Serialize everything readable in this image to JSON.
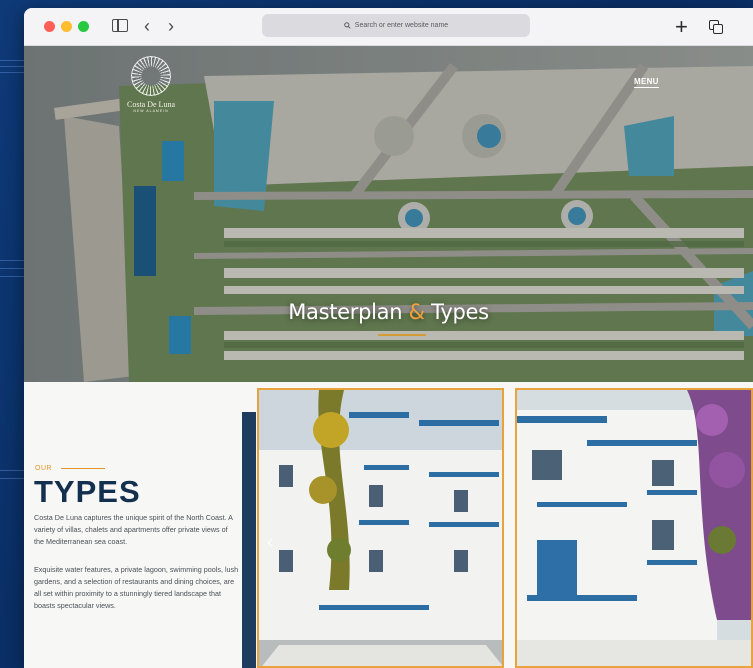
{
  "browser": {
    "url_placeholder": "Search or enter website name",
    "icons": [
      "sidebar-icon",
      "back-icon",
      "forward-icon",
      "search-icon",
      "new-tab-icon",
      "tabs-overview-icon"
    ]
  },
  "header": {
    "logo_name": "Costa De Luna",
    "logo_subtitle": "NEW ALAMEIN",
    "menu_label": "MENU"
  },
  "hero": {
    "title_part1": "Masterplan",
    "title_amp": "&",
    "title_part2": "Types",
    "accent_color": "#f2a23a"
  },
  "types_section": {
    "eyebrow": "OUR",
    "title": "TYPES",
    "paragraph1": "Costa De Luna captures the unique spirit of the North Coast. A variety of villas, chalets and apartments offer private views of the Mediterranean sea coast.",
    "paragraph2": "Exquisite water features, a private lagoon, swimming pools, lush gardens, and a selection of restaurants and dining choices, are all set within proximity to a stunningly tiered landscape that boasts spectacular views."
  },
  "colors": {
    "navy": "#13304f",
    "orange": "#e0962a",
    "page_bg": "#0c3673"
  }
}
